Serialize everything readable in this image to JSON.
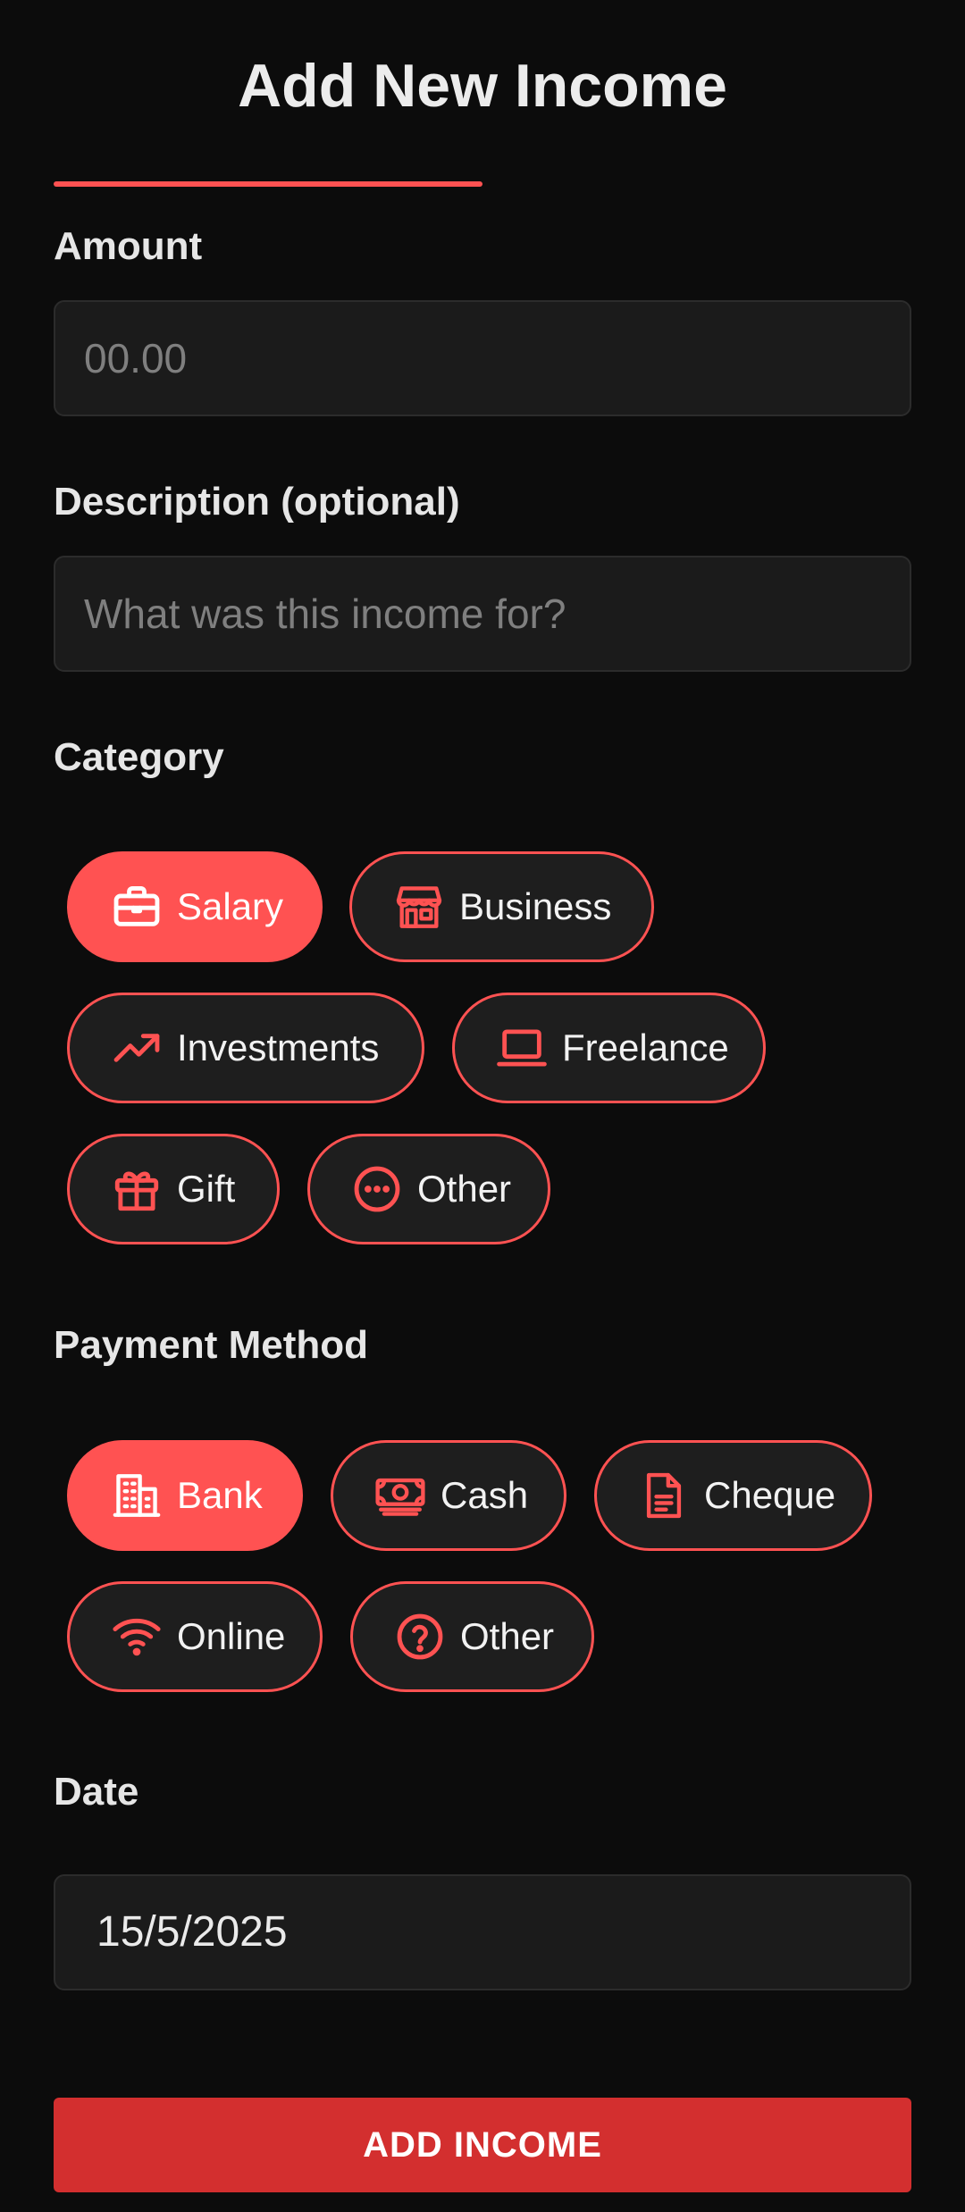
{
  "header": {
    "title": "Add New Income"
  },
  "colors": {
    "accent": "#ff5252",
    "button": "#d32f2f",
    "background": "#0c0c0c"
  },
  "amount": {
    "label": "Amount",
    "placeholder": "00.00",
    "value": ""
  },
  "description": {
    "label": "Description (optional)",
    "placeholder": "What was this income for?",
    "value": ""
  },
  "category": {
    "label": "Category",
    "selected": "Salary",
    "options": [
      {
        "label": "Salary",
        "icon": "briefcase-icon"
      },
      {
        "label": "Business",
        "icon": "storefront-icon"
      },
      {
        "label": "Investments",
        "icon": "trending-up-icon"
      },
      {
        "label": "Freelance",
        "icon": "laptop-icon"
      },
      {
        "label": "Gift",
        "icon": "gift-icon"
      },
      {
        "label": "Other",
        "icon": "more-horizontal-icon"
      }
    ]
  },
  "payment": {
    "label": "Payment Method",
    "selected": "Bank",
    "options": [
      {
        "label": "Bank",
        "icon": "building-icon"
      },
      {
        "label": "Cash",
        "icon": "cash-icon"
      },
      {
        "label": "Cheque",
        "icon": "document-icon"
      },
      {
        "label": "Online",
        "icon": "wifi-icon"
      },
      {
        "label": "Other",
        "icon": "help-circle-icon"
      }
    ]
  },
  "date": {
    "label": "Date",
    "value": "15/5/2025"
  },
  "submit": {
    "label": "ADD INCOME"
  }
}
